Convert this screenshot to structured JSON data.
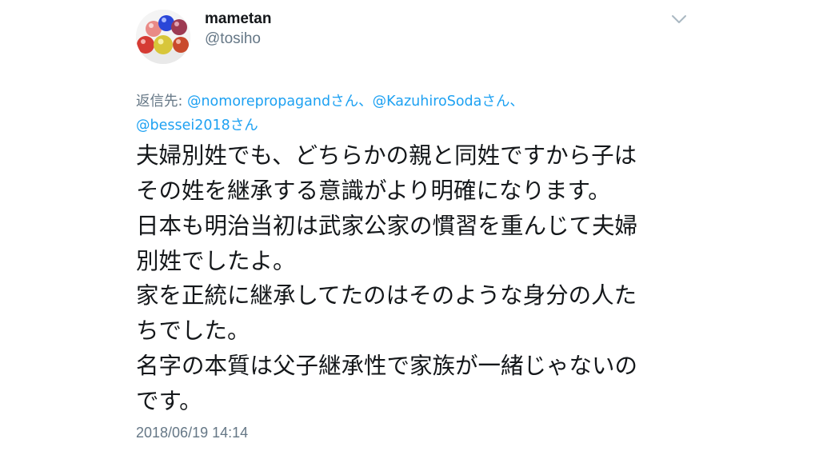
{
  "user": {
    "display_name": "mametan",
    "handle": "@tosiho",
    "avatar_icon": "marbles-avatar"
  },
  "reply_to": {
    "prefix": "返信先: ",
    "mentions": [
      {
        "handle": "@nomorepropagand",
        "suffix": "さん、"
      },
      {
        "handle": "@KazuhiroSoda",
        "suffix": "さん、"
      },
      {
        "handle": "@bessei2018",
        "suffix": "さん"
      }
    ]
  },
  "tweet": {
    "lines": [
      "夫婦別姓でも、どちらかの親と同姓ですから子は",
      "その姓を継承する意識がより明確になります。",
      "日本も明治当初は武家公家の慣習を重んじて夫婦",
      "別姓でしたよ。",
      "家を正統に継承してたのはそのような身分の人た",
      "ちでした。",
      "名字の本質は父子継承性で家族が一緒じゃないの",
      "です。"
    ],
    "timestamp": "2018/06/19 14:14"
  },
  "menu": {
    "icon": "chevron-down-icon"
  },
  "colors": {
    "link": "#1da1f2",
    "secondary": "#657786",
    "text": "#14171a"
  }
}
